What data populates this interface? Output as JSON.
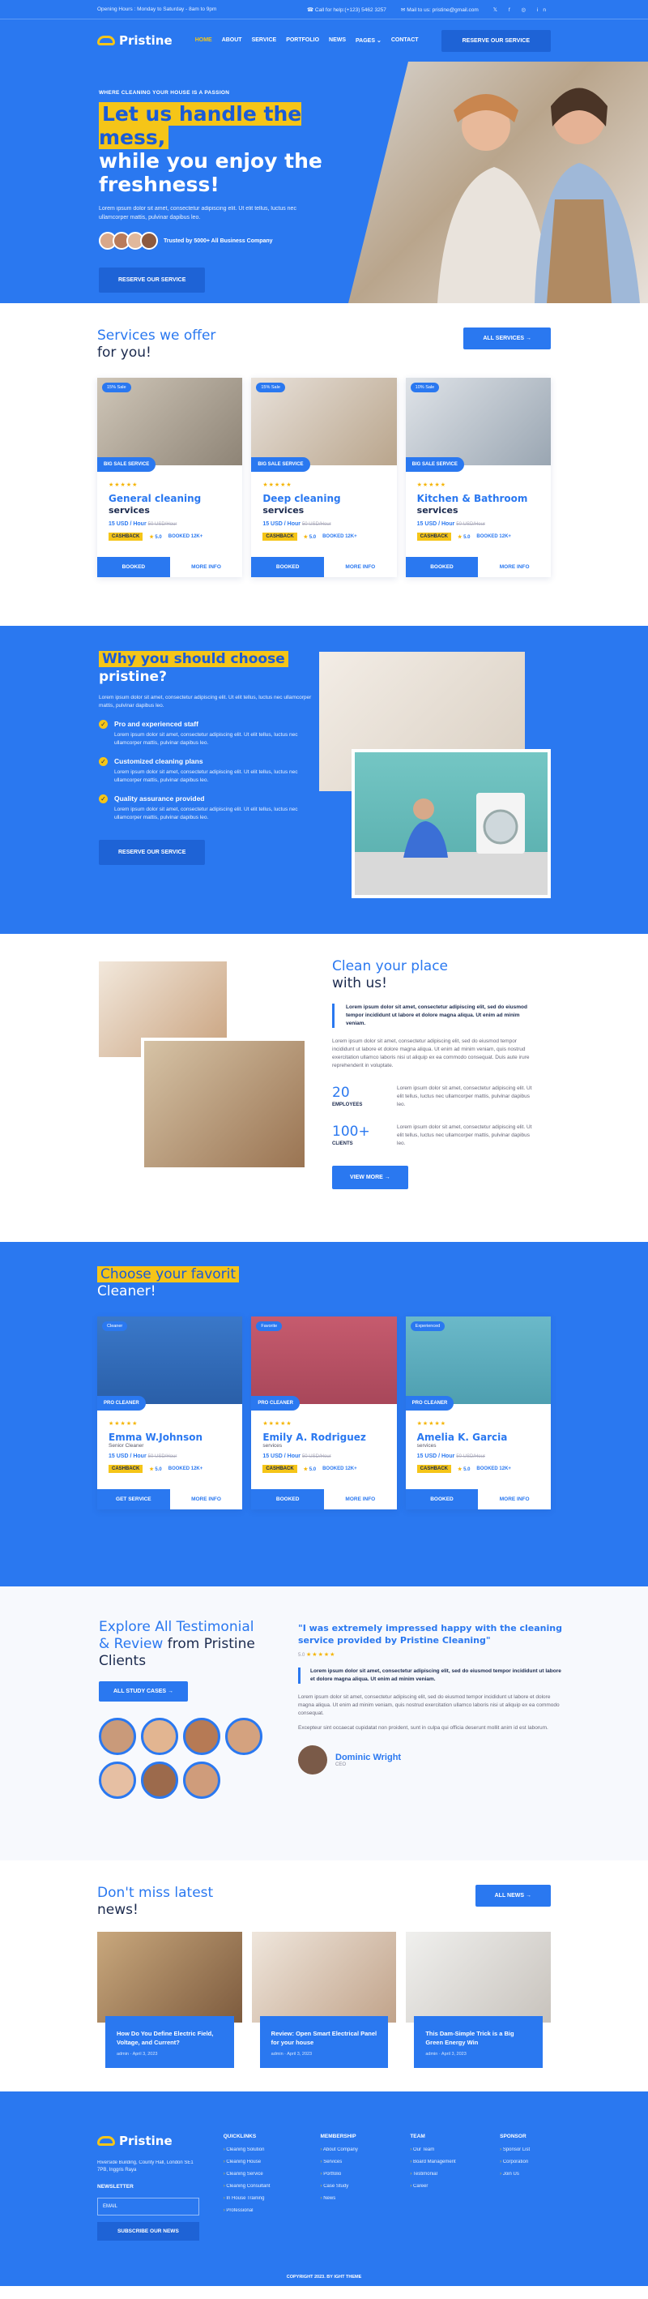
{
  "topbar": {
    "hours": "Opening Hours : Monday to Saturday - 8am to 9pm",
    "phone": "Call for help:(+123) 5462 3257",
    "email": "Mail to us: pristine@gmail.com"
  },
  "nav": {
    "logo": "Pristine",
    "items": [
      "HOME",
      "ABOUT",
      "SERVICE",
      "PORTFOLIO",
      "NEWS",
      "PAGES",
      "CONTACT"
    ],
    "cta": "RESERVE OUR SERVICE"
  },
  "hero": {
    "eyebrow": "WHERE CLEANING YOUR HOUSE IS A PASSION",
    "title_hl": "Let us handle the mess,",
    "title_rest": "while you enjoy the freshness!",
    "text": "Lorem ipsum dolor sit amet, consectetur adipiscing elit. Ut elit tellus, luctus nec ullamcorper mattis, pulvinar dapibus leo.",
    "trusted": "Trusted by 5000+ All Business Company",
    "cta": "RESERVE OUR SERVICE"
  },
  "services": {
    "title_c": "Services we offer",
    "title_d": "for you!",
    "all": "ALL SERVICES →",
    "cards": [
      {
        "tag": "15% Sale",
        "ribbon": "BIG SALE SERVICE",
        "rating": "5.0",
        "t1": "General cleaning",
        "t2": "services",
        "price": "15 USD / Hour",
        "old": "50 USD/Hour",
        "cb": "CASHBACK",
        "booked": "BOOKED 12K+",
        "b1": "BOOKED",
        "b2": "MORE INFO"
      },
      {
        "tag": "15% Sale",
        "ribbon": "BIG SALE SERVICE",
        "rating": "5.0",
        "t1": "Deep cleaning",
        "t2": "services",
        "price": "15 USD / Hour",
        "old": "50 USD/Hour",
        "cb": "CASHBACK",
        "booked": "BOOKED 12K+",
        "b1": "BOOKED",
        "b2": "MORE INFO"
      },
      {
        "tag": "10% Sale",
        "ribbon": "BIG SALE SERVICE",
        "rating": "5.0",
        "t1": "Kitchen & Bathroom",
        "t2": "services",
        "price": "15 USD / Hour",
        "old": "50 USD/Hour",
        "cb": "CASHBACK",
        "booked": "BOOKED 12K+",
        "b1": "BOOKED",
        "b2": "MORE INFO"
      }
    ]
  },
  "why": {
    "title_hl": "Why you should choose",
    "title_rest": "pristine?",
    "text": "Lorem ipsum dolor sit amet, consectetur adipiscing elit. Ut elit tellus, luctus nec ullamcorper mattis, pulvinar dapibus leo.",
    "features": [
      {
        "h": "Pro and experienced staff",
        "p": "Lorem ipsum dolor sit amet, consectetur adipiscing elit. Ut elit tellus, luctus nec ullamcorper mattis, pulvinar dapibus leo."
      },
      {
        "h": "Customized cleaning plans",
        "p": "Lorem ipsum dolor sit amet, consectetur adipiscing elit. Ut elit tellus, luctus nec ullamcorper mattis, pulvinar dapibus leo."
      },
      {
        "h": "Quality assurance provided",
        "p": "Lorem ipsum dolor sit amet, consectetur adipiscing elit. Ut elit tellus, luctus nec ullamcorper mattis, pulvinar dapibus leo."
      }
    ],
    "cta": "RESERVE OUR SERVICE"
  },
  "clean": {
    "title_c": "Clean your place",
    "title_d": "with us!",
    "quote": "Lorem ipsum dolor sit amet, consectetur adipiscing elit, sed do eiusmod tempor incididunt ut labore et dolore magna aliqua. Ut enim ad minim veniam.",
    "text": "Lorem ipsum dolor sit amet, consectetur adipiscing elit, sed do eiusmod tempor incididunt ut labore et dolore magna aliqua. Ut enim ad minim veniam, quis nostrud exercitation ullamco laboris nisi ut aliquip ex ea commodo consequat. Duis aute irure reprehenderit in voluptate.",
    "stats": [
      {
        "n": "20",
        "l": "EMPLOYEES",
        "p": "Lorem ipsum dolor sit amet, consectetur adipiscing elit. Ut elit tellus, luctus nec ullamcorper mattis, pulvinar dapibus leo."
      },
      {
        "n": "100+",
        "l": "CLIENTS",
        "p": "Lorem ipsum dolor sit amet, consectetur adipiscing elit. Ut elit tellus, luctus nec ullamcorper mattis, pulvinar dapibus leo."
      }
    ],
    "cta": "VIEW MORE →"
  },
  "team": {
    "title_hl": "Choose your favorit",
    "title_rest": "Cleaner!",
    "cards": [
      {
        "tag": "Cleaner",
        "ribbon": "PRO CLEANER",
        "rating": "5.0",
        "name": "Emma W.Johnson",
        "role": "Senior Cleaner",
        "price": "15 USD / Hour",
        "old": "50 USD/Hour",
        "cb": "CASHBACK",
        "booked": "BOOKED 12K+",
        "b1": "GET SERVICE",
        "b2": "MORE INFO"
      },
      {
        "tag": "Favorite",
        "ribbon": "PRO CLEANER",
        "rating": "5.0",
        "name": "Emily A. Rodriguez",
        "role": "services",
        "price": "15 USD / Hour",
        "old": "50 USD/Hour",
        "cb": "CASHBACK",
        "booked": "BOOKED 12K+",
        "b1": "BOOKED",
        "b2": "MORE INFO"
      },
      {
        "tag": "Experienced",
        "ribbon": "PRO CLEANER",
        "rating": "5.0",
        "name": "Amelia K. Garcia",
        "role": "services",
        "price": "15 USD / Hour",
        "old": "50 USD/Hour",
        "cb": "CASHBACK",
        "booked": "BOOKED 12K+",
        "b1": "BOOKED",
        "b2": "MORE INFO"
      }
    ]
  },
  "testimonial": {
    "title_c": "Explore All Testimonial & Review",
    "title_d": "from Pristine Clients",
    "cta": "ALL STUDY CASES →",
    "quote": "\"I was extremely impressed happy with the cleaning service provided by Pristine Cleaning\"",
    "rating": "5.0",
    "bold": "Lorem ipsum dolor sit amet, consectetur adipiscing elit, sed do eiusmod tempor incididunt ut labore et dolore magna aliqua. Ut enim ad minim veniam.",
    "text1": "Lorem ipsum dolor sit amet, consectetur adipiscing elit, sed do eiusmod tempor incididunt ut labore et dolore magna aliqua. Ut enim ad minim veniam, quis nostrud exercitation ullamco laboris nisi ut aliquip ex ea commodo consequat.",
    "text2": "Excepteur sint occaecat cupidatat non proident, sunt in culpa qui officia deserunt mollit anim id est laborum.",
    "name": "Dominic Wright",
    "role": "CEO"
  },
  "news": {
    "title_c": "Don't miss latest",
    "title_d": "news!",
    "all": "ALL NEWS →",
    "items": [
      {
        "t": "How Do You Define Electric Field, Voltage, and Current?",
        "m": "admin · April 3, 2023"
      },
      {
        "t": "Review: Open Smart Electrical Panel for your house",
        "m": "admin · April 3, 2023"
      },
      {
        "t": "This Dam-Simple Trick is a Big Green Energy Win",
        "m": "admin · April 3, 2023"
      }
    ]
  },
  "footer": {
    "logo": "Pristine",
    "address": "Riverside Building, County Hall, London SE1 7PB, Inggris Raya",
    "newsletter": "NEWSLETTER",
    "email_ph": "EMAIL",
    "subscribe": "SUBSCRIBE OUR NEWS",
    "cols": [
      {
        "h": "QUICKLINKS",
        "items": [
          "Cleaning Solution",
          "Cleaning House",
          "Cleaning Service",
          "Cleaning Consultant",
          "In House Training",
          "Professional"
        ]
      },
      {
        "h": "MEMBERSHIP",
        "items": [
          "About Company",
          "Services",
          "Portfolio",
          "Case Study",
          "News"
        ]
      },
      {
        "h": "TEAM",
        "items": [
          "Our Team",
          "Board Management",
          "Testimonial",
          "Career"
        ]
      },
      {
        "h": "SPONSOR",
        "items": [
          "Sponsor List",
          "Corporation",
          "Join Us"
        ]
      }
    ],
    "copyright": "COPYRIGHT 2023. BY IGHT THEME"
  }
}
